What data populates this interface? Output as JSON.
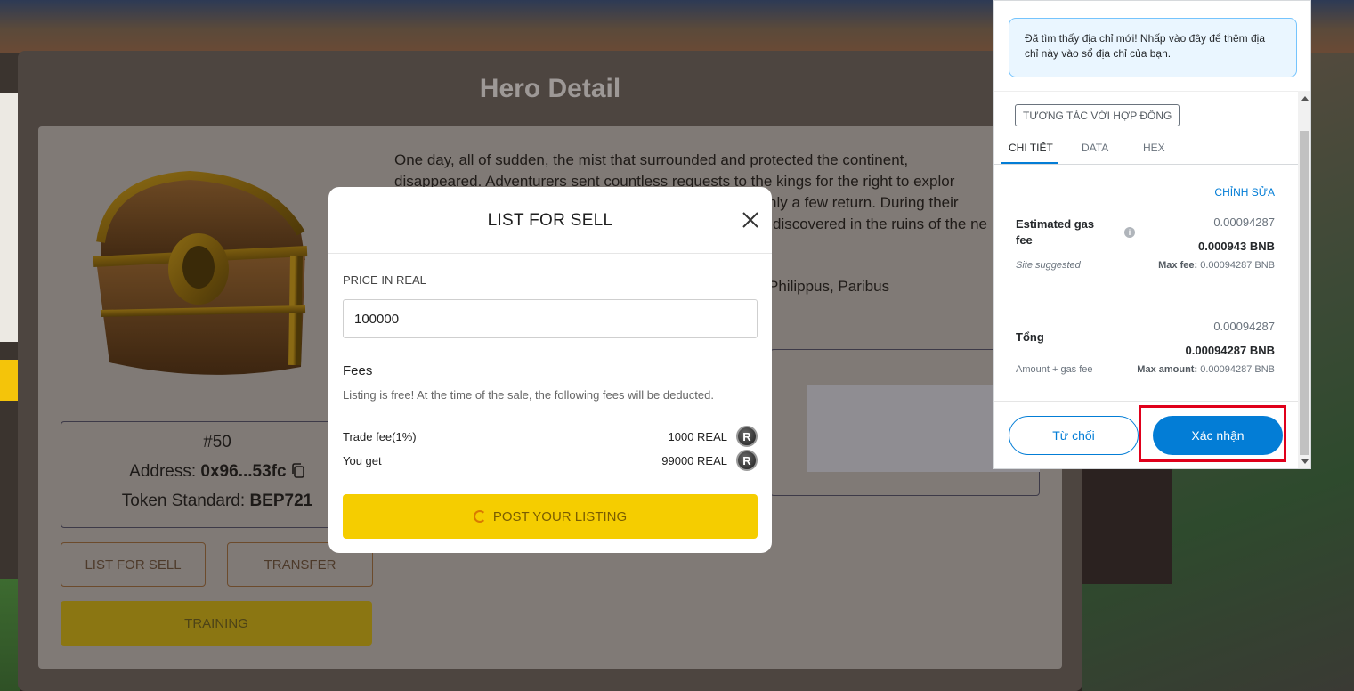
{
  "hero_detail": {
    "title": "Hero Detail",
    "description": "One day, all of sudden, the mist that surrounded and protected the continent, disappeared. Adventurers sent countless requests to the kings for the right to explore... only a few return. During their ... discovered in the ruins of the ne...",
    "desc_line1": "One day, all of sudden, the mist that surrounded and protected the continent,",
    "desc_line2": "disappeared. Adventurers sent countless requests to the kings for the right to explor",
    "desc_line3": "nly a few return. During their",
    "desc_line4": "discovered in the ruins of the ne",
    "desc_line5": "Philippus, Paribus",
    "token_id": "#50",
    "address_label": "Address:",
    "address_value": "0x96...53fc",
    "standard_label": "Token Standard:",
    "standard_value": "BEP721",
    "list_for_sell_button": "LIST FOR SELL",
    "transfer_button": "TRANSFER",
    "training_button": "TRAINING"
  },
  "list_for_sell": {
    "title": "LIST FOR SELL",
    "price_label": "PRICE IN REAL",
    "price_value": "100000",
    "fees_title": "Fees",
    "fees_note": "Listing is free! At the time of the sale, the following fees will be deducted.",
    "trade_fee_label": "Trade fee(1%)",
    "trade_fee_value": "1000 REAL",
    "you_get_label": "You get",
    "you_get_value": "99000 REAL",
    "coin_symbol": "R",
    "post_button": "POST YOUR LISTING"
  },
  "metamask": {
    "notice": "Đã tìm thấy địa chỉ mới! Nhấp vào đây để thêm địa chỉ này vào sổ địa chỉ của bạn.",
    "contract_tag": "TƯƠNG TÁC VỚI HỢP ĐỒNG",
    "tabs": [
      "CHI TIẾT",
      "DATA",
      "HEX"
    ],
    "edit": "CHỈNH SỬA",
    "gas_label_1": "Estimated gas",
    "gas_label_2": "fee",
    "gas_value_grey": "0.00094287",
    "gas_value_bold": "0.000943 BNB",
    "site_suggested": "Site suggested",
    "max_fee_label": "Max fee:",
    "max_fee_value": "0.00094287 BNB",
    "total_label": "Tổng",
    "total_value_grey": "0.00094287",
    "total_value_bold": "0.00094287 BNB",
    "amount_gas": "Amount + gas fee",
    "max_amount_label": "Max amount:",
    "max_amount_value": "0.00094287 BNB",
    "reject_button": "Từ chối",
    "confirm_button": "Xác nhận"
  },
  "colors": {
    "metamask_blue": "#037dd6",
    "post_button_yellow": "#f5cd00",
    "highlight_red": "#e0001b"
  }
}
